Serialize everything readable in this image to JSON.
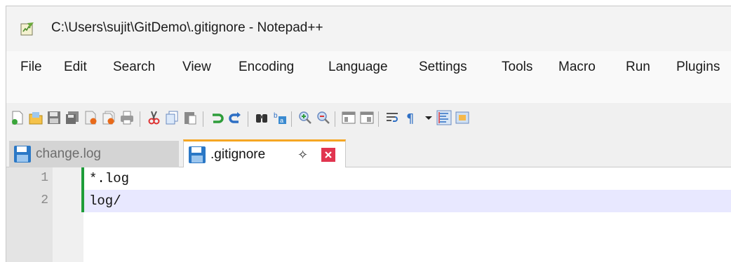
{
  "window": {
    "title": "C:\\Users\\sujit\\GitDemo\\.gitignore - Notepad++"
  },
  "menu": [
    {
      "label": "File"
    },
    {
      "label": "Edit"
    },
    {
      "label": "Search"
    },
    {
      "label": "View"
    },
    {
      "label": "Encoding"
    },
    {
      "label": "Language"
    },
    {
      "label": "Settings"
    },
    {
      "label": "Tools"
    },
    {
      "label": "Macro"
    },
    {
      "label": "Run"
    },
    {
      "label": "Plugins"
    }
  ],
  "toolbar": {
    "buttons": [
      "new-file-icon",
      "open-file-icon",
      "save-icon",
      "save-all-icon",
      "close-icon",
      "close-all-icon",
      "print-icon",
      "cut-icon",
      "copy-icon",
      "paste-icon",
      "undo-icon",
      "redo-icon",
      "find-icon",
      "replace-icon",
      "zoom-in-icon",
      "zoom-out-icon",
      "sync-vertical-icon",
      "sync-horizontal-icon",
      "word-wrap-icon",
      "show-all-characters-icon",
      "dropdown-arrow-icon",
      "indent-guide-icon",
      "doc-map-icon"
    ]
  },
  "tabs": [
    {
      "label": "change.log",
      "active": false
    },
    {
      "label": ".gitignore",
      "active": true
    }
  ],
  "editor": {
    "lines": [
      {
        "number": "1",
        "text": "*.log"
      },
      {
        "number": "2",
        "text": "log/"
      }
    ],
    "current_line": 2
  },
  "colors": {
    "active_tab_accent": "#f5a623",
    "change_bar": "#1e9d3a",
    "current_line_bg": "#e8e8ff",
    "close_tab": "#e1354f"
  }
}
